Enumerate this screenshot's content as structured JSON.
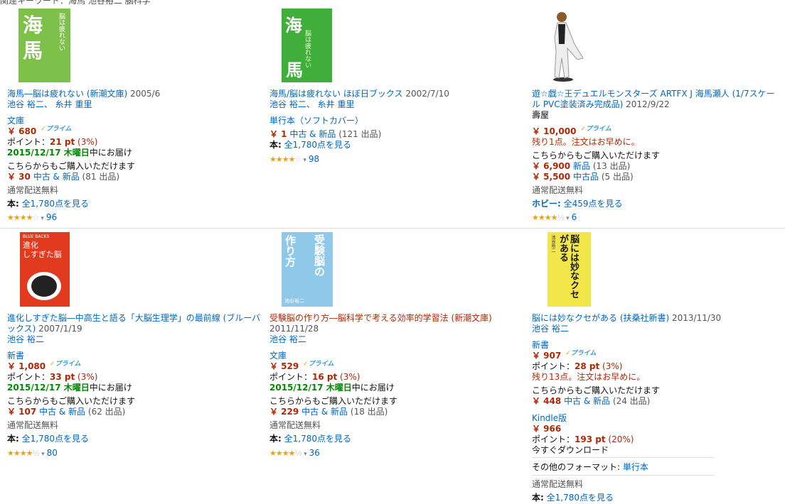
{
  "top_fragment": "関連キーワード：海馬 池谷裕二 脳科学",
  "products": [
    {
      "cover": {
        "bg": "#7dc04a",
        "lines": [
          "海",
          "馬"
        ],
        "fg": "#ffffff",
        "sub": "脳は疲れない"
      },
      "title": "海馬―脳は疲れない (新潮文庫)",
      "date": "2005/6",
      "author": "池谷 裕二、 糸井 重里",
      "format": "文庫",
      "price": "￥ 680",
      "points_label": "ポイント：",
      "points": "21 pt",
      "points_pct": "(3%)",
      "delivery_date": "2015/12/17 木曜日",
      "delivery_suffix": "中にお届け",
      "other_label": "こちらからもご購入いただけます",
      "other_price": "￥ 30",
      "other_link": "中古 & 新品",
      "other_count": "(81 出品)",
      "shipping": "通常配送無料",
      "see_all_cat": "本:",
      "see_all": "全1,780点を見る",
      "stars": "★★★★",
      "stars_empty": "☆",
      "reviews": "96"
    },
    {
      "cover": {
        "bg": "#3fae3a",
        "lines": [
          "海",
          "馬"
        ],
        "fg": "#ffffff",
        "sub": "脳は疲れない"
      },
      "title": "海馬/脳は疲れない ほぼ日ブックス",
      "date": "2002/7/10",
      "author": "池谷 裕二、 糸井 重里",
      "format": "単行本（ソフトカバー）",
      "price": "￥ 1",
      "price_link": "中古 & 新品",
      "price_count": "(121 出品)",
      "see_all_cat": "本:",
      "see_all": "全1,780点を見る",
      "stars": "★★★★",
      "stars_empty": "☆",
      "reviews": "98"
    },
    {
      "cover": {
        "bg": "#ffffff"
      },
      "title1": "遊☆戯☆王デュエルモンスターズ ARTFX J 海馬瀬人 (1/7スケー",
      "title2": "ル PVC塗装済み完成品)",
      "date": "2012/9/22",
      "maker": "壽屋",
      "price": "￥ 10,000",
      "stock": "残り1点。注文はお早めに。",
      "other_label": "こちらからもご購入いただけます",
      "new_price": "￥ 6,900",
      "new_link": "新品",
      "new_count": "(13 出品)",
      "used_price": "￥ 5,500",
      "used_link": "中古品",
      "used_count": "(5 出品)",
      "shipping": "通常配送無料",
      "see_all_cat": "ホビー:",
      "see_all": "全459点を見る",
      "stars": "★★★★",
      "stars_empty": "½",
      "reviews": "6"
    },
    {
      "cover": {
        "bg": "#e23a1e",
        "top": "BLUE BACKS",
        "lines": [
          "進化",
          "しすぎた脳"
        ],
        "fg": "#ffffff"
      },
      "title1": "進化しすぎた脳―中高生と語る「大脳生理学」の最前線 (ブルーバ",
      "title2": "ックス)",
      "date": "2007/1/19",
      "author": "池谷 裕二",
      "format": "新書",
      "price": "￥ 1,080",
      "points_label": "ポイント：",
      "points": "33 pt",
      "points_pct": "(3%)",
      "delivery_date": "2015/12/17 木曜日",
      "delivery_suffix": "中にお届け",
      "other_label": "こちらからもご購入いただけます",
      "other_price": "￥ 107",
      "other_link": "中古 & 新品",
      "other_count": "(62 出品)",
      "shipping": "通常配送無料",
      "see_all_cat": "本:",
      "see_all": "全1,780点を見る",
      "stars": "★★★★",
      "stars_empty": "½",
      "reviews": "80"
    },
    {
      "cover": {
        "bg": "#8fc8e8",
        "lines": [
          "受験",
          "脳の",
          "作り方"
        ],
        "fg": "#ffffff",
        "sub": "池谷裕二"
      },
      "title": "受験脳の作り方―脳科学で考える効率的学習法 (新潮文庫)",
      "date": "2011/11/28",
      "author": "池谷 裕二",
      "format": "文庫",
      "price": "￥ 529",
      "points_label": "ポイント：",
      "points": "16 pt",
      "points_pct": "(3%)",
      "delivery_date": "2015/12/17 木曜日",
      "delivery_suffix": "中にお届け",
      "other_label": "こちらからもご購入いただけます",
      "other_price": "￥ 229",
      "other_link": "中古 & 新品",
      "other_count": "(18 出品)",
      "shipping": "通常配送無料",
      "see_all_cat": "本:",
      "see_all": "全1,780点を見る",
      "stars": "★★★★",
      "stars_empty": "½",
      "reviews": "36"
    },
    {
      "cover": {
        "bg": "#f2e64a",
        "lines": [
          "脳には",
          "妙な",
          "クセがある"
        ],
        "fg": "#1a1a1a",
        "sub": "池谷裕二"
      },
      "title": "脳には妙なクセがある (扶桑社新書)",
      "date": "2013/11/30",
      "author": "池谷 裕二",
      "format": "新書",
      "price": "￥ 907",
      "points_label": "ポイント：",
      "points": "28 pt",
      "points_pct": "(3%)",
      "stock": "残り13点。注文はお早めに。",
      "other_label": "こちらからもご購入いただけます",
      "other_price": "￥ 448",
      "other_link": "中古 & 新品",
      "other_count": "(24 出品)",
      "kindle_format": "Kindle版",
      "kindle_price": "￥ 966",
      "kindle_points_label": "ポイント：",
      "kindle_points": "193 pt",
      "kindle_points_pct": "(20%)",
      "download": "今すぐダウンロード",
      "other_formats_label": "その他のフォーマット:",
      "other_formats_link": "単行本",
      "shipping": "通常配送無料",
      "see_all_cat": "本:",
      "see_all": "全1,780点を見る"
    }
  ],
  "prime_label": "プライム",
  "colors": {
    "link": "#0066c0",
    "price": "#b12704",
    "delivery": "#008a00",
    "star": "#f0a000",
    "prime": "#3399cc"
  }
}
